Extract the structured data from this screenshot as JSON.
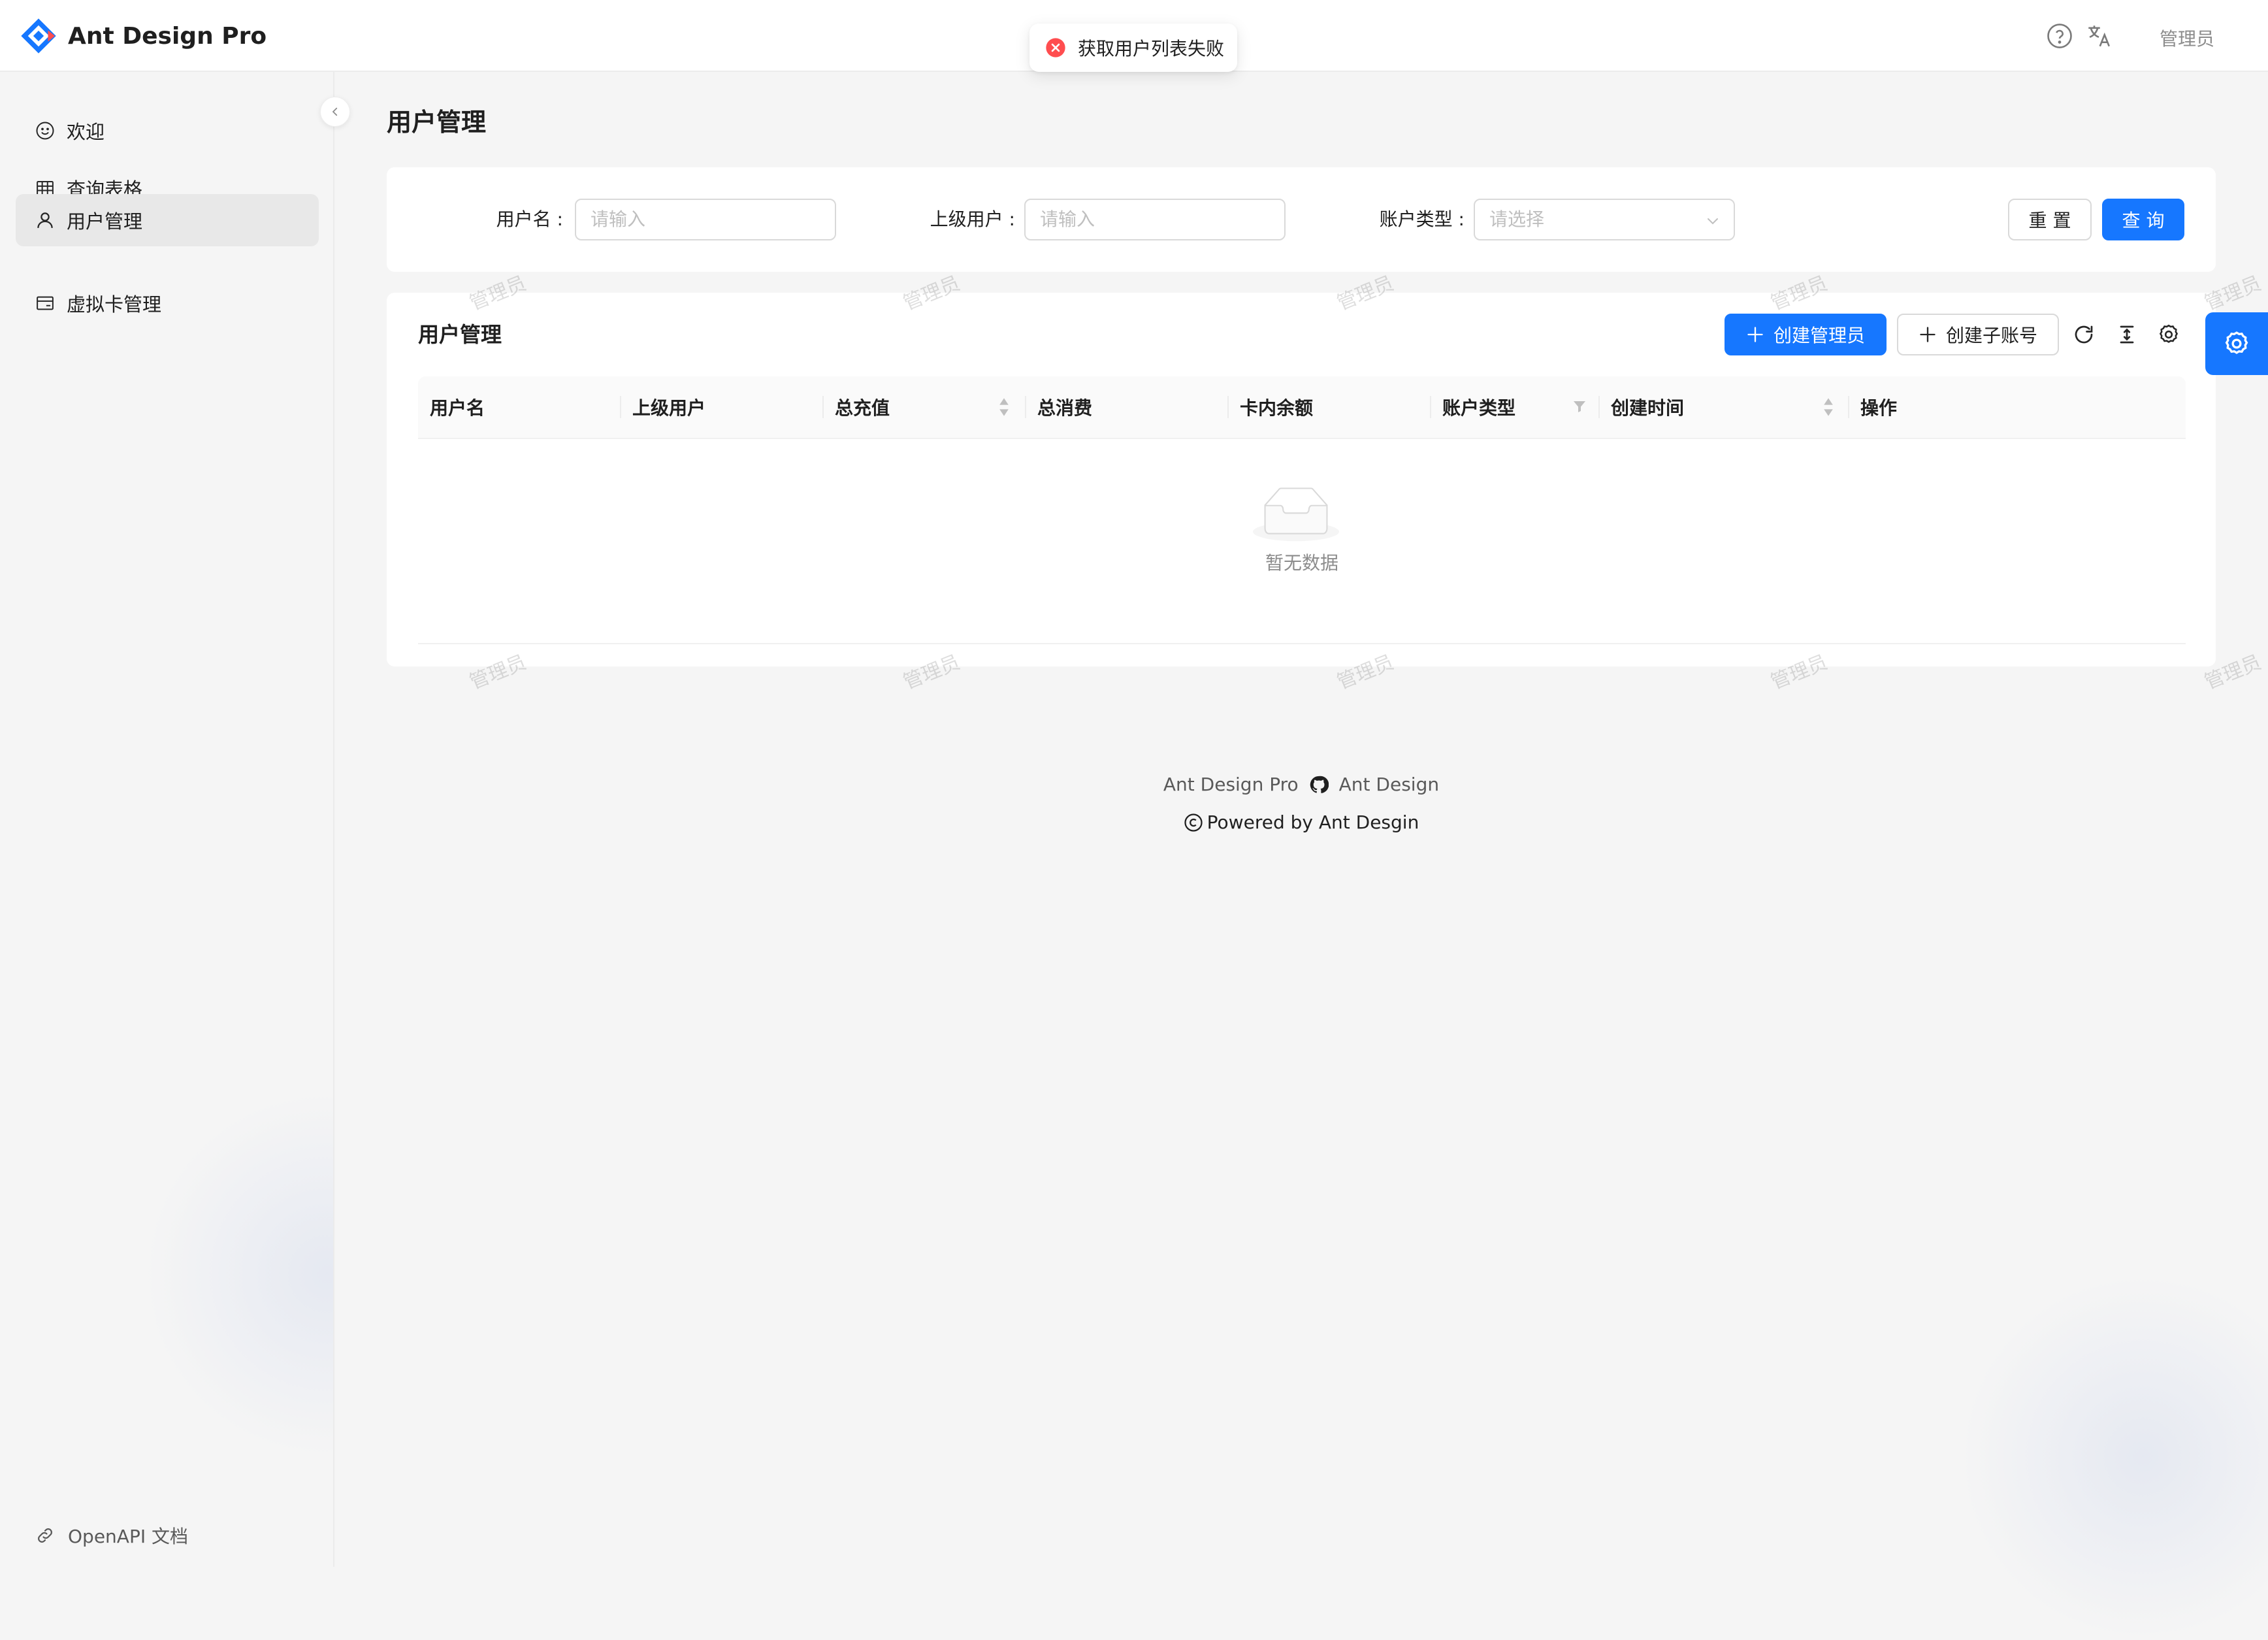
{
  "app": {
    "title": "Ant Design Pro"
  },
  "header": {
    "user_name": "管理员",
    "help_icon": "question-circle-icon",
    "lang_icon": "translation-icon"
  },
  "toast": {
    "text": "获取用户列表失败",
    "icon": "close-circle-icon",
    "color": "#ff4d4f"
  },
  "sidebar": {
    "items": [
      {
        "label": "欢迎",
        "icon": "smile-icon",
        "active": false
      },
      {
        "label": "查询表格",
        "icon": "table-icon",
        "active": false
      },
      {
        "label": "用户管理",
        "icon": "user-icon",
        "active": true
      },
      {
        "label": "虚拟卡管理",
        "icon": "credit-card-icon",
        "active": false
      }
    ],
    "bottom_link": "OpenAPI 文档"
  },
  "page": {
    "title": "用户管理"
  },
  "search_form": {
    "username": {
      "label": "用户名 :",
      "placeholder": "请输入",
      "value": ""
    },
    "parent_user": {
      "label": "上级用户 :",
      "placeholder": "请输入",
      "value": ""
    },
    "account_type": {
      "label": "账户类型 :",
      "placeholder": "请选择",
      "value": ""
    },
    "reset_label": "重 置",
    "query_label": "查 询"
  },
  "table": {
    "title": "用户管理",
    "create_admin_label": "创建管理员",
    "create_sub_label": "创建子账号",
    "columns": [
      {
        "label": "用户名",
        "sortable": false,
        "filterable": false
      },
      {
        "label": "上级用户",
        "sortable": false,
        "filterable": false
      },
      {
        "label": "总充值",
        "sortable": true,
        "filterable": false
      },
      {
        "label": "总消费",
        "sortable": false,
        "filterable": false
      },
      {
        "label": "卡内余额",
        "sortable": false,
        "filterable": false
      },
      {
        "label": "账户类型",
        "sortable": false,
        "filterable": true
      },
      {
        "label": "创建时间",
        "sortable": true,
        "filterable": false
      },
      {
        "label": "操作",
        "sortable": false,
        "filterable": false
      }
    ],
    "rows": [],
    "empty_text": "暂无数据"
  },
  "footer": {
    "link_left": "Ant Design Pro",
    "link_right": "Ant Design",
    "copyright": "Powered by Ant Desgin"
  },
  "watermark": {
    "text": "管理员"
  },
  "colors": {
    "primary": "#1677ff",
    "error": "#ff4d4f",
    "background": "#f5f5f5"
  }
}
